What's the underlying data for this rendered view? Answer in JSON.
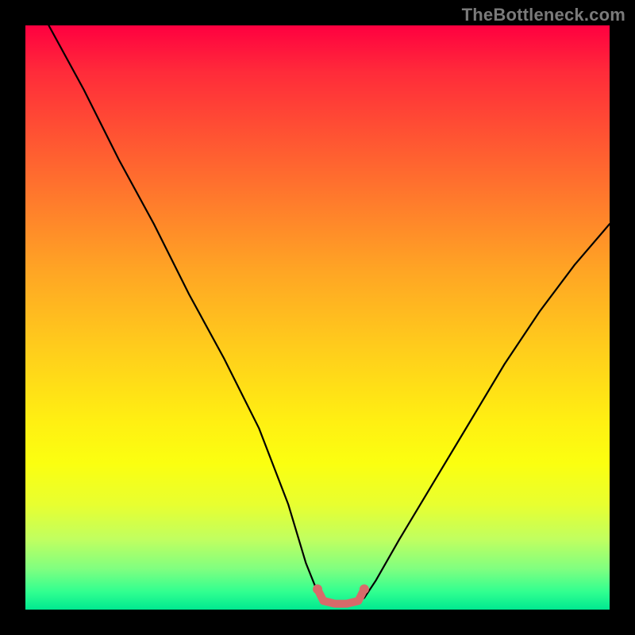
{
  "watermark": "TheBottleneck.com",
  "chart_data": {
    "type": "line",
    "title": "",
    "xlabel": "",
    "ylabel": "",
    "xlim": [
      0,
      100
    ],
    "ylim": [
      0,
      100
    ],
    "series": [
      {
        "name": "bottleneck-curve",
        "x": [
          4,
          10,
          16,
          22,
          28,
          34,
          40,
          45,
          48,
          50,
          52,
          54,
          56,
          58,
          60,
          64,
          70,
          76,
          82,
          88,
          94,
          100
        ],
        "y": [
          100,
          89,
          77,
          66,
          54,
          43,
          31,
          18,
          8,
          3,
          1,
          1,
          1,
          2,
          5,
          12,
          22,
          32,
          42,
          51,
          59,
          66
        ]
      },
      {
        "name": "bottom-marker",
        "x": [
          50,
          51,
          53,
          55,
          57,
          58
        ],
        "y": [
          3.5,
          1.5,
          1,
          1,
          1.5,
          3.5
        ]
      }
    ],
    "gradient_bands": [
      {
        "pct": 0,
        "color": "#ff0040"
      },
      {
        "pct": 50,
        "color": "#ffcc1c"
      },
      {
        "pct": 85,
        "color": "#fbff10"
      },
      {
        "pct": 100,
        "color": "#00e890"
      }
    ]
  }
}
